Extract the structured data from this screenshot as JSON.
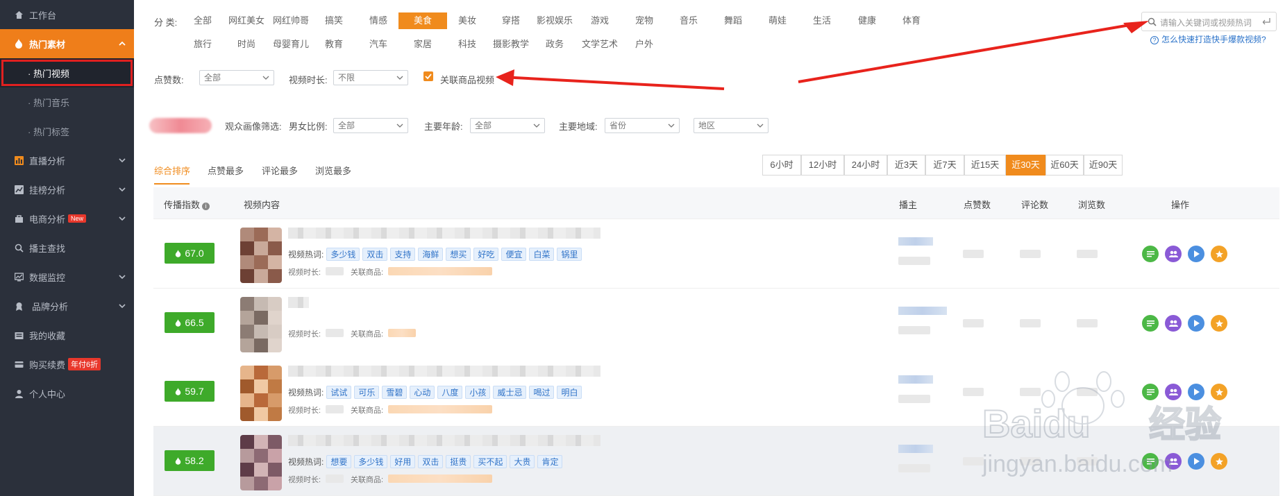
{
  "sidebar": {
    "items": [
      {
        "label": "工作台",
        "icon": "home-icon"
      },
      {
        "label": "热门素材",
        "icon": "fire-icon",
        "active": true
      },
      {
        "label": "直播分析",
        "icon": "chart-bar-icon"
      },
      {
        "label": "挂榜分析",
        "icon": "trend-icon"
      },
      {
        "label": "电商分析",
        "icon": "shop-icon",
        "badge": "New"
      },
      {
        "label": "播主查找",
        "icon": "search-icon"
      },
      {
        "label": "数据监控",
        "icon": "monitor-icon"
      },
      {
        "label": "品牌分析",
        "icon": "brand-icon"
      },
      {
        "label": "我的收藏",
        "icon": "folder-icon"
      },
      {
        "label": "购买续费",
        "icon": "cart-icon",
        "badge": "年付6折"
      },
      {
        "label": "个人中心",
        "icon": "user-icon"
      }
    ],
    "sub_items": [
      "· 热门视频",
      "· 热门音乐",
      "· 热门标签"
    ]
  },
  "filters": {
    "category_label": "分    类:",
    "categories_row1": [
      "全部",
      "网红美女",
      "网红帅哥",
      "搞笑",
      "情感",
      "美食",
      "美妆",
      "穿搭",
      "影视娱乐",
      "游戏",
      "宠物",
      "音乐",
      "舞蹈",
      "萌娃",
      "生活",
      "健康",
      "体育"
    ],
    "categories_row2": [
      "旅行",
      "时尚",
      "母婴育儿",
      "教育",
      "汽车",
      "家居",
      "科技",
      "摄影教学",
      "政务",
      "文学艺术",
      "户外"
    ],
    "selected_category": "美食",
    "likes_label": "点赞数:",
    "likes_value": "全部",
    "duration_label": "视频时长:",
    "duration_value": "不限",
    "related_goods_label": "关联商品视频",
    "audience_label": "观众画像筛选:",
    "gender_label": "男女比例:",
    "gender_value": "全部",
    "age_label": "主要年龄:",
    "age_value": "全部",
    "region_label": "主要地域:",
    "province_value": "省份",
    "area_value": "地区"
  },
  "search": {
    "placeholder": "请输入关键词或视频热词",
    "help_link": "怎么快速打造快手爆款视频?"
  },
  "sort_tabs": [
    "综合排序",
    "点赞最多",
    "评论最多",
    "浏览最多"
  ],
  "time_ranges": [
    "6小时",
    "12小时",
    "24小时",
    "近3天",
    "近7天",
    "近15天",
    "近30天",
    "近60天",
    "近90天"
  ],
  "selected_time_range": "近30天",
  "table": {
    "headers": {
      "index": "传播指数",
      "content": "视频内容",
      "host": "播主",
      "likes": "点赞数",
      "comments": "评论数",
      "views": "浏览数",
      "ops": "操作"
    },
    "hot_words_label": "视频热词:",
    "duration_label": "视频时长:",
    "goods_label": "关联商品:",
    "rows": [
      {
        "score": "67.0",
        "tags": [
          "多少钱",
          "双击",
          "支持",
          "海鲜",
          "想买",
          "好吃",
          "便宜",
          "白菜",
          "锅里"
        ]
      },
      {
        "score": "66.5",
        "tags": []
      },
      {
        "score": "59.7",
        "tags": [
          "试试",
          "可乐",
          "雪碧",
          "心动",
          "八度",
          "小孩",
          "威士忌",
          "喝过",
          "明白"
        ]
      },
      {
        "score": "58.2",
        "tags": [
          "想要",
          "多少钱",
          "好用",
          "双击",
          "挺贵",
          "买不起",
          "大贵",
          "肯定"
        ]
      }
    ]
  },
  "colors": {
    "accent": "#f08b1d",
    "sidebar_bg": "#2b303b",
    "score_green": "#3eaa2a",
    "arrow_red": "#e8231c"
  },
  "watermark": {
    "brand": "Baidu",
    "cn": "经验",
    "url": "jingyan.baidu.com"
  }
}
